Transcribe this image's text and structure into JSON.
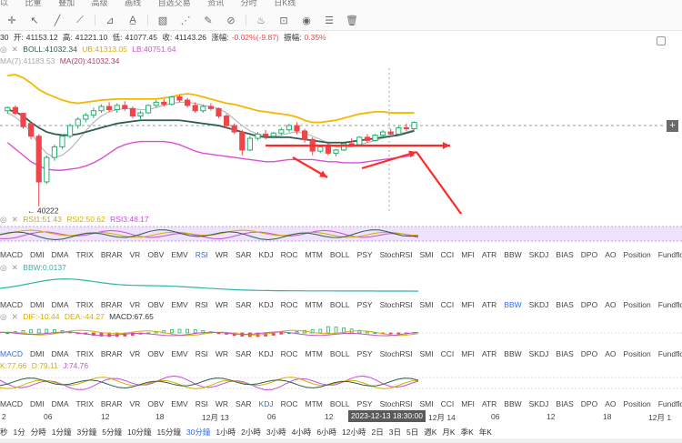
{
  "toolbar": {
    "top_texts": [
      "以",
      "比重",
      "叠加",
      "高级",
      "画线",
      "自选交易",
      "资讯",
      "分时",
      "日K线"
    ],
    "icons": [
      "crosshair-icon",
      "cursor-icon",
      "line-icon",
      "trend-icon",
      "measure-icon",
      "text-icon",
      "fib-icon",
      "pattern-icon",
      "brush-icon",
      "ruler-icon",
      "magnet-icon",
      "lock-icon",
      "eye-icon",
      "layers-icon",
      "trash-icon"
    ]
  },
  "main_info": {
    "open_label": "开:",
    "open": "41153.12",
    "high_label": "高:",
    "high": "41221.10",
    "low_label": "低:",
    "low": "41077.45",
    "close_label": "收:",
    "close": "41143.26",
    "change_label": "涨幅:",
    "change": "-0.02%(-9.87)",
    "amp_label": "振幅:",
    "amp": "0.35%",
    "prefix": "30"
  },
  "boll_info": {
    "boll": "BOLL:41032.34",
    "ub": "UB:41313.05",
    "lb": "LB:40751.64"
  },
  "ma_info": {
    "ma7": "MA(7):41183.53",
    "ma20": "MA(20):41032.34"
  },
  "low_marker": "40222",
  "rsi_info": {
    "rsi1": "RSI1:51.43",
    "rsi2": "RSI2:50.62",
    "rsi3": "RSI3:48.17"
  },
  "bbw_info": {
    "bbw": "BBW:0.0137"
  },
  "macd_info": {
    "dif": "DIF:-10.44",
    "dea": "DEA:-44.27",
    "macd": "MACD:67.65"
  },
  "kdj_info": {
    "k": "K:77.66",
    "d": "D:79.11",
    "j": "J:74.76"
  },
  "tabs_row1": [
    "MACD",
    "DMI",
    "DMA",
    "TRIX",
    "BRAR",
    "VR",
    "OBV",
    "EMV",
    "RSI",
    "WR",
    "SAR",
    "KDJ",
    "ROC",
    "MTM",
    "BOLL",
    "PSY",
    "StochRSI",
    "SMI",
    "CCI",
    "MFI",
    "ATR",
    "BBW",
    "SKDJ",
    "BIAS",
    "DPO",
    "AO",
    "Position",
    "Fundflow"
  ],
  "tabs_row2": [
    "MACD",
    "DMI",
    "DMA",
    "TRIX",
    "BRAR",
    "VR",
    "OBV",
    "EMV",
    "RSI",
    "WR",
    "SAR",
    "KDJ",
    "ROC",
    "MTM",
    "BOLL",
    "PSY",
    "StochRSI",
    "SMI",
    "CCI",
    "MFI",
    "ATR",
    "BBW",
    "SKDJ",
    "BIAS",
    "DPO",
    "AO",
    "Position",
    "Fundflow"
  ],
  "tabs_row3": [
    "MACD",
    "DMI",
    "DMA",
    "TRIX",
    "BRAR",
    "VR",
    "OBV",
    "EMV",
    "RSI",
    "WR",
    "SAR",
    "KDJ",
    "ROC",
    "MTM",
    "BOLL",
    "PSY",
    "StochRSI",
    "SMI",
    "CCI",
    "MFI",
    "ATR",
    "BBW",
    "SKDJ",
    "BIAS",
    "DPO",
    "AO",
    "Position",
    "Fundflow"
  ],
  "tabs_row4": [
    "MACD",
    "DMI",
    "DMA",
    "TRIX",
    "BRAR",
    "VR",
    "OBV",
    "EMV",
    "RSI",
    "WR",
    "SAR",
    "KDJ",
    "ROC",
    "MTM",
    "BOLL",
    "PSY",
    "StochRSI",
    "SMI",
    "CCI",
    "MFI",
    "ATR",
    "BBW",
    "SKDJ",
    "BIAS",
    "DPO",
    "AO",
    "Position",
    "Fundflow"
  ],
  "active_tabs": {
    "row1": "RSI",
    "row2": "BBW",
    "row3": "MACD",
    "row4": "KDJ"
  },
  "time_axis": [
    "2",
    "06",
    "12",
    "18",
    "12月 13",
    "06",
    "12",
    "12月 14",
    "06",
    "12",
    "18",
    "12月 1"
  ],
  "crosshair_time": "2023-12-13 18:30:00",
  "periods": [
    "秒",
    "1分",
    "分時",
    "1分鐘",
    "3分鐘",
    "5分鐘",
    "10分鐘",
    "15分鐘",
    "30分鐘",
    "1小時",
    "2小時",
    "3小時",
    "4小時",
    "6小時",
    "12小時",
    "2日",
    "3日",
    "5日",
    "週K",
    "月K",
    "季K",
    "年K"
  ],
  "active_period": "30分鐘",
  "colors": {
    "up": "#20b26c",
    "down": "#ef454a",
    "ub": "#f5b800",
    "boll": "#2f5d50",
    "lb": "#d94fd6",
    "annot": "#ff2a2a",
    "active": "#2f6cf5"
  },
  "candles": [
    [
      0,
      41120,
      41160,
      41090,
      41150
    ],
    [
      1,
      41150,
      41170,
      41080,
      41095
    ],
    [
      2,
      41095,
      41100,
      40950,
      40970
    ],
    [
      3,
      41000,
      41010,
      40850,
      40880
    ],
    [
      4,
      40880,
      40900,
      40222,
      40450
    ],
    [
      5,
      40450,
      40700,
      40430,
      40680
    ],
    [
      6,
      40680,
      40800,
      40650,
      40780
    ],
    [
      7,
      40780,
      40900,
      40760,
      40880
    ],
    [
      8,
      40880,
      41000,
      40860,
      40980
    ],
    [
      9,
      40980,
      41060,
      40950,
      41040
    ],
    [
      10,
      41040,
      41100,
      41010,
      41080
    ],
    [
      11,
      41080,
      41150,
      41050,
      41120
    ],
    [
      12,
      41120,
      41180,
      41100,
      41160
    ],
    [
      13,
      41160,
      41200,
      41110,
      41130
    ],
    [
      14,
      41130,
      41190,
      41100,
      41170
    ],
    [
      15,
      41170,
      41210,
      41120,
      41140
    ],
    [
      16,
      41140,
      41160,
      41050,
      41070
    ],
    [
      17,
      41070,
      41120,
      41040,
      41100
    ],
    [
      18,
      41100,
      41180,
      41090,
      41170
    ],
    [
      19,
      41170,
      41220,
      41150,
      41200
    ],
    [
      20,
      41200,
      41230,
      41160,
      41180
    ],
    [
      21,
      41180,
      41260,
      41170,
      41250
    ],
    [
      22,
      41250,
      41270,
      41200,
      41220
    ],
    [
      23,
      41220,
      41240,
      41150,
      41170
    ],
    [
      24,
      41170,
      41200,
      41100,
      41120
    ],
    [
      25,
      41120,
      41180,
      41100,
      41160
    ],
    [
      26,
      41160,
      41190,
      41120,
      41140
    ],
    [
      27,
      41140,
      41150,
      41050,
      41070
    ],
    [
      28,
      41070,
      41090,
      40950,
      40980
    ],
    [
      29,
      40980,
      41000,
      40900,
      40920
    ],
    [
      30,
      40920,
      40940,
      40700,
      40750
    ],
    [
      31,
      40750,
      40880,
      40740,
      40860
    ],
    [
      32,
      40860,
      40920,
      40840,
      40900
    ],
    [
      33,
      40900,
      40940,
      40850,
      40880
    ],
    [
      34,
      40880,
      40920,
      40860,
      40910
    ],
    [
      35,
      40910,
      40960,
      40890,
      40940
    ],
    [
      36,
      40940,
      41000,
      40920,
      40980
    ],
    [
      37,
      40980,
      41010,
      40900,
      40930
    ],
    [
      38,
      40930,
      40950,
      40820,
      40850
    ],
    [
      39,
      40850,
      40870,
      40700,
      40740
    ],
    [
      40,
      40740,
      40800,
      40720,
      40780
    ],
    [
      41,
      40780,
      40820,
      40700,
      40720
    ],
    [
      42,
      40720,
      40760,
      40690,
      40750
    ],
    [
      43,
      40750,
      40820,
      40740,
      40810
    ],
    [
      44,
      40810,
      40860,
      40780,
      40800
    ],
    [
      45,
      40800,
      40880,
      40790,
      40870
    ],
    [
      46,
      40870,
      40900,
      40820,
      40840
    ],
    [
      47,
      40840,
      40900,
      40830,
      40890
    ],
    [
      48,
      40890,
      40940,
      40870,
      40920
    ],
    [
      49,
      40920,
      40950,
      40880,
      40900
    ],
    [
      50,
      40900,
      40980,
      40890,
      40960
    ],
    [
      51,
      40960,
      41000,
      40930,
      40950
    ],
    [
      52,
      40950,
      41020,
      40940,
      41010
    ]
  ],
  "ub_line": [
    41450,
    41460,
    41430,
    41380,
    41320,
    41280,
    41250,
    41220,
    41200,
    41190,
    41200,
    41210,
    41220,
    41225,
    41230,
    41230,
    41230,
    41230,
    41230,
    41230,
    41240,
    41250,
    41270,
    41280,
    41270,
    41250,
    41230,
    41210,
    41190,
    41180,
    41160,
    41140,
    41120,
    41110,
    41100,
    41090,
    41080,
    41060,
    41030,
    41010,
    41010,
    41020,
    41030,
    41050,
    41070,
    41090,
    41100,
    41110,
    41110,
    41100,
    41100,
    41100,
    41100
  ],
  "boll_line": [
    41130,
    41110,
    41070,
    41010,
    40960,
    40920,
    40900,
    40890,
    40890,
    40900,
    40920,
    40940,
    40960,
    40980,
    41000,
    41010,
    41020,
    41030,
    41030,
    41030,
    41030,
    41030,
    41030,
    41020,
    41010,
    41000,
    40990,
    40980,
    40960,
    40940,
    40920,
    40900,
    40880,
    40870,
    40870,
    40870,
    40870,
    40860,
    40850,
    40840,
    40830,
    40820,
    40820,
    40820,
    40830,
    40840,
    40850,
    40860,
    40870,
    40880,
    40890,
    40910,
    40930
  ],
  "lb_line": [
    40820,
    40760,
    40700,
    40640,
    40600,
    40570,
    40560,
    40560,
    40570,
    40580,
    40600,
    40630,
    40670,
    40720,
    40770,
    40800,
    40820,
    40830,
    40830,
    40830,
    40830,
    40820,
    40800,
    40770,
    40740,
    40720,
    40710,
    40700,
    40690,
    40680,
    40670,
    40660,
    40650,
    40640,
    40640,
    40650,
    40660,
    40660,
    40660,
    40660,
    40650,
    40640,
    40640,
    40630,
    40630,
    40630,
    40640,
    40650,
    40660,
    40670,
    40680,
    40690,
    40700
  ],
  "ma7_line": [
    41100,
    41060,
    41000,
    40920,
    40800,
    40720,
    40680,
    40700,
    40760,
    40840,
    40930,
    41010,
    41070,
    41110,
    41130,
    41140,
    41140,
    41130,
    41130,
    41150,
    41170,
    41190,
    41200,
    41200,
    41190,
    41170,
    41160,
    41140,
    41100,
    41040,
    40980,
    40930,
    40900,
    40880,
    40880,
    40890,
    40910,
    40920,
    40910,
    40880,
    40850,
    40810,
    40780,
    40770,
    40780,
    40800,
    40820,
    40840,
    40860,
    40880,
    40900,
    40920,
    40940
  ]
}
